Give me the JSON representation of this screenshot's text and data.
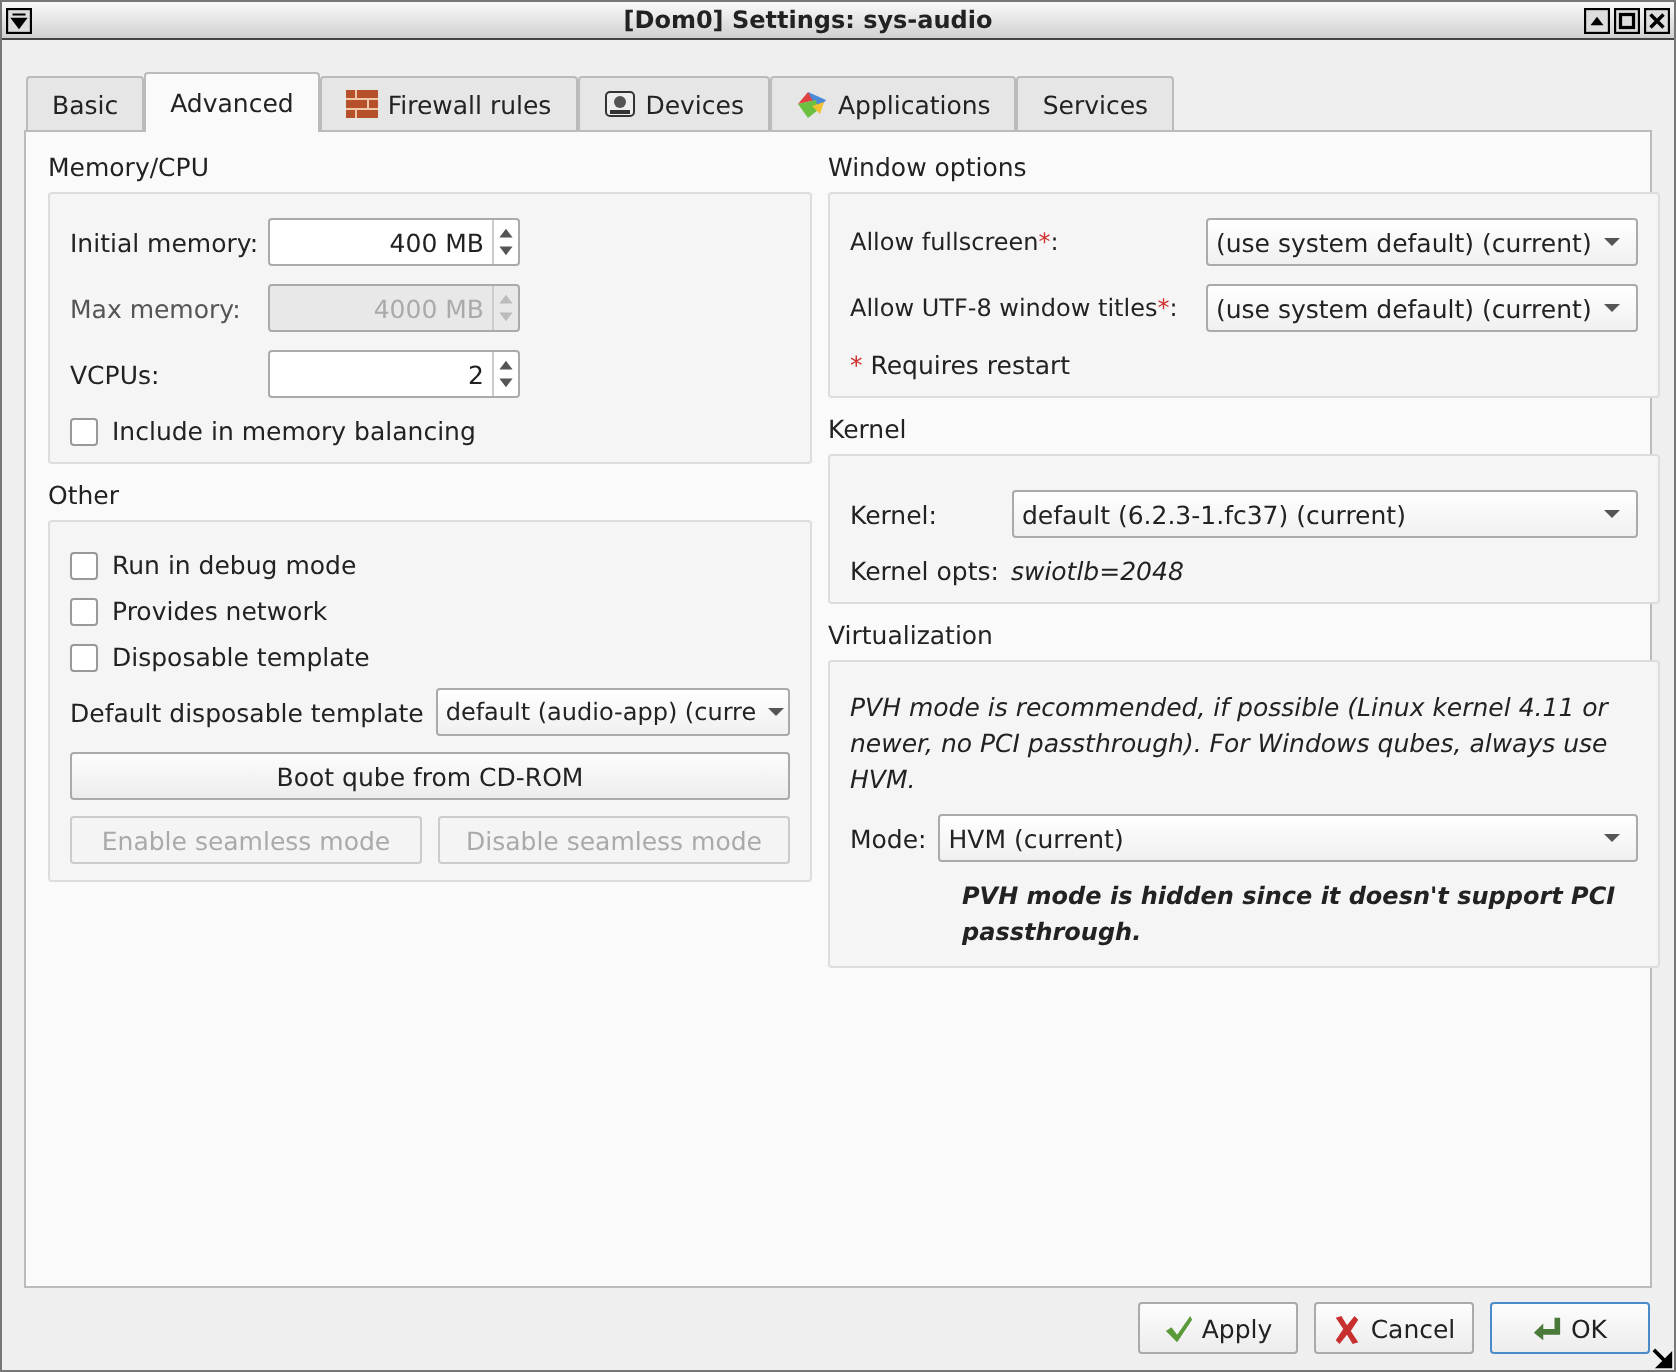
{
  "window": {
    "title": "[Dom0] Settings: sys-audio"
  },
  "tabs": [
    {
      "label": "Basic",
      "selected": false,
      "kind": "plain"
    },
    {
      "label": "Advanced",
      "selected": true,
      "kind": "plain"
    },
    {
      "label": "Firewall rules",
      "selected": false,
      "kind": "firewall"
    },
    {
      "label": "Devices",
      "selected": false,
      "kind": "devices"
    },
    {
      "label": "Applications",
      "selected": false,
      "kind": "applications"
    },
    {
      "label": "Services",
      "selected": false,
      "kind": "plain"
    }
  ],
  "memory_cpu": {
    "title": "Memory/CPU",
    "fields": [
      {
        "label": "Initial memory:",
        "value": "400 MB",
        "disabled": false
      },
      {
        "label": "Max memory:",
        "value": "4000 MB",
        "disabled": true
      },
      {
        "label": "VCPUs:",
        "value": "2",
        "disabled": false
      }
    ],
    "checkbox": {
      "label": "Include in memory balancing",
      "checked": false
    }
  },
  "other": {
    "title": "Other",
    "checkboxes": [
      {
        "label": "Run in debug mode",
        "checked": false
      },
      {
        "label": "Provides network",
        "checked": false
      },
      {
        "label": "Disposable template",
        "checked": false
      }
    ],
    "default_disposable": {
      "label": "Default disposable template",
      "value": "default (audio-app) (curre"
    },
    "boot_button": {
      "label": "Boot qube from CD-ROM",
      "disabled": false
    },
    "seamless_buttons": [
      {
        "label": "Enable seamless mode",
        "disabled": true
      },
      {
        "label": "Disable seamless mode",
        "disabled": true
      }
    ]
  },
  "window_options": {
    "title": "Window options",
    "fields": [
      {
        "label": "Allow fullscreen",
        "mark": "*",
        "colon": ":",
        "value": "(use system default) (current)"
      },
      {
        "label": "Allow UTF-8 window titles",
        "mark": "*",
        "colon": ":",
        "value": "(use system default) (current)"
      }
    ],
    "note": {
      "mark": "*",
      "text": "Requires restart"
    }
  },
  "kernel": {
    "title": "Kernel",
    "kernel": {
      "label": "Kernel:",
      "value": "default (6.2.3-1.fc37) (current)"
    },
    "opts": {
      "label": "Kernel opts:",
      "value": "swiotlb=2048"
    }
  },
  "virtualization": {
    "title": "Virtualization",
    "description": "PVH mode is recommended, if possible (Linux kernel 4.11 or newer, no PCI passthrough). For Windows qubes, always use HVM.",
    "mode": {
      "label": "Mode:",
      "value": "HVM (current)"
    },
    "warning": "PVH mode is hidden since it doesn't support PCI passthrough."
  },
  "buttons": [
    {
      "label": "Apply",
      "kind": "apply",
      "default": false
    },
    {
      "label": "Cancel",
      "kind": "cancel",
      "default": false
    },
    {
      "label": "OK",
      "kind": "ok",
      "default": true
    }
  ]
}
